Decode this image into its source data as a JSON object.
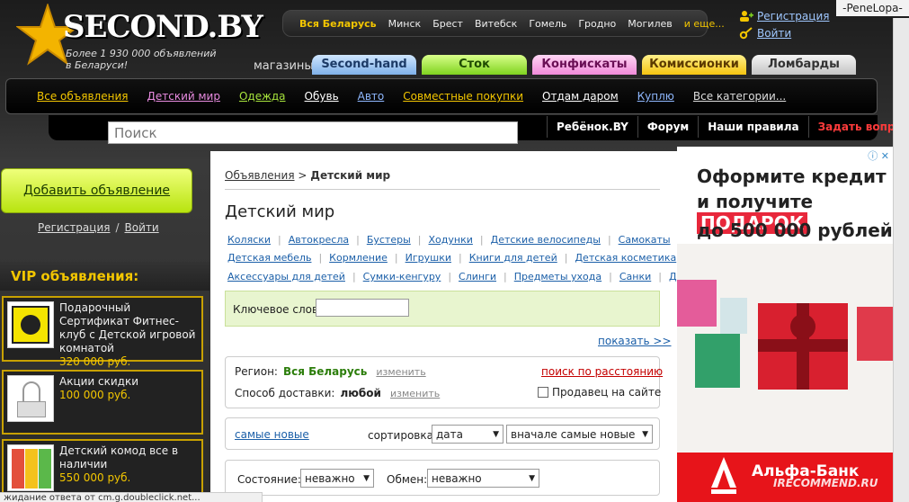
{
  "header": {
    "logo_text": "SECOND.BY",
    "logo_sub_1": "Более 1 930 000 объявлений",
    "logo_sub_2": "в Беларуси!",
    "regions": [
      "Вся Беларусь",
      "Минск",
      "Брест",
      "Витебск",
      "Гомель",
      "Гродно",
      "Могилев",
      "и еще..."
    ],
    "register_label": "Регистрация",
    "login_label": "Войти",
    "username": "-PeneLopa-"
  },
  "stores": {
    "label": "магазины:",
    "tabs": [
      "Second-hand",
      "Сток",
      "Конфискаты",
      "Комиссионки",
      "Ломбарды"
    ]
  },
  "categories": {
    "items": [
      {
        "label": "Все объявления",
        "color": "#f3c600"
      },
      {
        "label": "Детский мир",
        "color": "#e88be0"
      },
      {
        "label": "Одежда",
        "color": "#a6e33c"
      },
      {
        "label": "Обувь",
        "color": "#ffffff"
      },
      {
        "label": "Авто",
        "color": "#8fb8ff"
      },
      {
        "label": "Совместные покупки",
        "color": "#f3c600"
      },
      {
        "label": "Отдам даром",
        "color": "#ffffff"
      },
      {
        "label": "Куплю",
        "color": "#8fb8ff"
      },
      {
        "label": "Все категории...",
        "color": "#dddddd"
      }
    ]
  },
  "search": {
    "placeholder": "Поиск"
  },
  "nav": {
    "links": [
      "Ребёнок.BY",
      "Форум",
      "Наши правила",
      "Задать вопрос"
    ]
  },
  "left": {
    "add_button": "Добавить объявление",
    "register": "Регистрация",
    "separator": "/",
    "login": "Войти",
    "vip_title": "VIP объявления:",
    "vip": [
      {
        "title": "Подарочный Сертификат Фитнес-клуб с Детской игровой комнатой",
        "price": "320 000 руб."
      },
      {
        "title": "Акции скидки",
        "price": "100 000 руб."
      },
      {
        "title": "Детский комод все в наличии",
        "price": "550 000 руб."
      }
    ]
  },
  "main": {
    "breadcrumb_root": "Объявления",
    "breadcrumb_sep": ">",
    "breadcrumb_current": "Детский мир",
    "title": "Детский мир",
    "subcats_row1": [
      "Коляски",
      "Автокресла",
      "Бустеры",
      "Ходунки",
      "Детские велосипеды",
      "Самокаты"
    ],
    "subcats_row2": [
      "Детская мебель",
      "Кормление",
      "Игрушки",
      "Книги для детей",
      "Детская косметика"
    ],
    "subcats_row3": [
      "Аксессуары для детей",
      "Сумки-кенгуру",
      "Слинги",
      "Предметы ухода",
      "Санки",
      "Другое"
    ],
    "keyword_label": "Ключевое слово:",
    "keyword_value": "",
    "show_more": "показать >>",
    "region_label": "Регион:",
    "region_value": "Вся Беларусь",
    "change_label": "изменить",
    "distance_search": "поиск по расстоянию",
    "delivery_label": "Способ доставки:",
    "delivery_value": "любой",
    "seller_on_site": "Продавец на сайте",
    "newest": "самые новые",
    "sort_label": "сортировка:",
    "sort_field": "дата",
    "sort_order": "вначале самые новые",
    "condition_label": "Состояние:",
    "condition_value": "неважно",
    "exchange_label": "Обмен:",
    "exchange_value": "неважно"
  },
  "ad": {
    "line1": "Оформите кредит",
    "line2_pre": "и получите",
    "line2_gift": "ПОДАРОК",
    "line3": "до 500 000 рублей",
    "bank": "Альфа-Банк"
  },
  "watermark": "IRECOMMEND.RU",
  "status_bar": "жидание ответа от cm.g.doubleclick.net..."
}
